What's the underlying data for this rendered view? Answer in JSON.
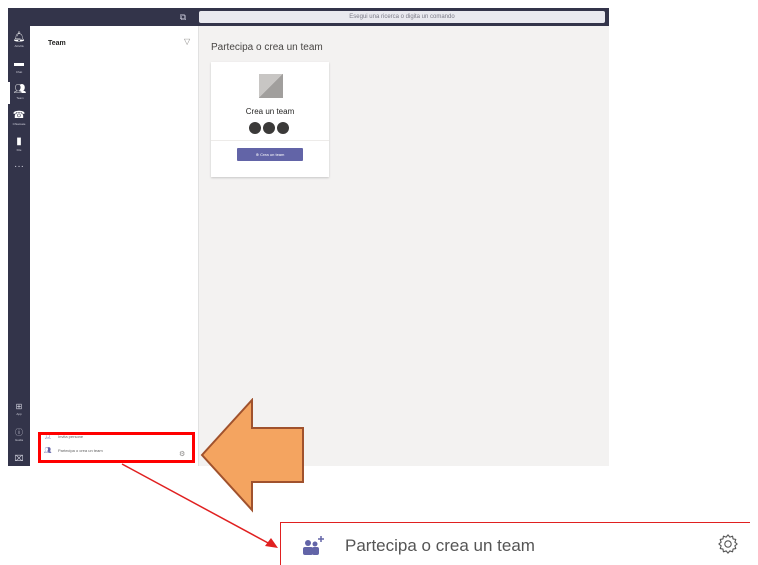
{
  "top_fragment": "",
  "titlebar": {
    "search_placeholder": "Esegui una ricerca o digita un comando"
  },
  "rail": {
    "items": [
      {
        "label": "Attività",
        "icon": "bell-icon"
      },
      {
        "label": "Chat",
        "icon": "chat-icon"
      },
      {
        "label": "Team",
        "icon": "team-icon"
      },
      {
        "label": "Chiamate",
        "icon": "phone-icon"
      },
      {
        "label": "File",
        "icon": "file-icon"
      }
    ],
    "more": "···",
    "bottom": [
      {
        "label": "App",
        "icon": "apps-icon"
      },
      {
        "label": "Guida",
        "icon": "help-icon"
      }
    ]
  },
  "pane": {
    "title": "Team",
    "links": [
      {
        "label": "Invita persone",
        "icon": "invite-icon"
      },
      {
        "label": "Partecipa o crea un team",
        "icon": "team-add-icon"
      }
    ]
  },
  "main": {
    "heading": "Partecipa o crea un team",
    "card": {
      "title": "Crea un team",
      "button": "Crea un team"
    }
  },
  "callout": {
    "label": "Partecipa o crea un team"
  },
  "colors": {
    "rail": "#33344a",
    "brand": "#6264a7",
    "highlight": "#ff0000",
    "arrow_fill": "#f4a460",
    "arrow_stroke": "#a0522d"
  }
}
